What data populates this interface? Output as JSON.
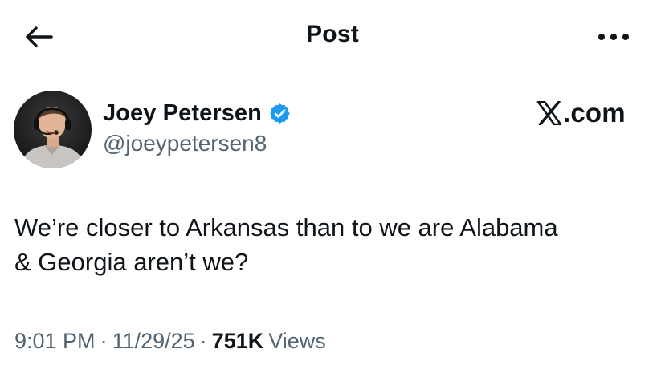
{
  "header": {
    "title": "Post",
    "back_icon": "arrow-left-icon",
    "more_icon": "more-horizontal-icon"
  },
  "author": {
    "name": "Joey Petersen",
    "handle": "@joeypetersen8",
    "verified": true,
    "verified_color": "#1d9bf0",
    "avatar_icon": "avatar-photo"
  },
  "watermark": {
    "text": ".com",
    "logo_icon": "x-logo-icon"
  },
  "post": {
    "lines": [
      "We’re closer to Arkansas than to we are Alabama",
      "& Georgia aren’t we?"
    ]
  },
  "meta": {
    "time": "9:01 PM",
    "separator": "·",
    "date": "11/29/25",
    "views_count": "751K",
    "views_label": "Views"
  },
  "colors": {
    "text_primary": "#0f1419",
    "text_secondary": "#536471",
    "background": "#ffffff"
  }
}
